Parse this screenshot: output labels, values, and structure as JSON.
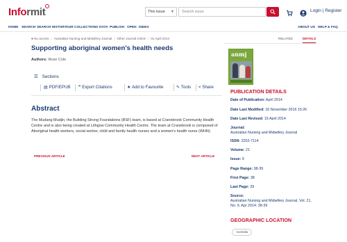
{
  "brand": {
    "logo_part1": "Info",
    "logo_part2": "rmit",
    "accent_color": "#c8102e",
    "link_color": "#1a3a6e"
  },
  "header": {
    "scope_select": "This issue",
    "search_placeholder": "Search issue",
    "search_icon": "search-icon",
    "cart_icon": "cart-icon",
    "user_icon": "user-icon",
    "login_label": "Login | Register"
  },
  "nav": {
    "left": [
      "HOME",
      "SEARCH",
      "SEARCH HISTORY",
      "OUR COLLECTIONS",
      "DATA",
      "PUBLISH",
      "OPEN",
      "INDEX"
    ],
    "right": [
      "ABOUT US",
      "HELP & FAQ"
    ]
  },
  "article": {
    "access": "No access",
    "journal": "Australian Nursing and Midwifery Journal",
    "type": "Other Journal Article",
    "date": "01 April 2014",
    "title": "Supporting aboriginal women's health needs",
    "authors_label": "Authors:",
    "authors_value": "Rose Cole",
    "sections_label": "Sections",
    "tools": {
      "pdf": "PDF/EPUB",
      "export": "Export Citations",
      "favourite": "Add to Favourite",
      "tools": "Tools",
      "share": "Share"
    },
    "abstract_heading": "Abstract",
    "abstract_text": "The Mudang Mudjin, the Building Strong Foundations (BSF) team, is based at Cranebrook Community Health Centre and is also being created at Lithgow Community Health Centre. The team at Cranebrook is composed of Aboriginal health workers, social worker, child and family health nurses and a women's health nurse (WHN).",
    "previous": "PREVIOUS ARTICLE",
    "next": "NEXT ARTICLE"
  },
  "panel": {
    "tabs": [
      "RELATED",
      "DETAILS"
    ],
    "active_tab": "DETAILS",
    "cover_title": "anmj",
    "publication_heading": "PUBLICATION DETAILS",
    "date_of_publication_label": "Date of Publication:",
    "date_of_publication": "April 2014",
    "last_modified_label": "Date Last Modified:",
    "last_modified": "16 November 2016 15:26",
    "last_revised_label": "Date Last Revised:",
    "last_revised": "15 April 2014",
    "journal_label": "Journal:",
    "journal": "Australian Nursing and Midwifery Journal",
    "issn_label": "ISSN:",
    "issn": "2202-7114",
    "volume_label": "Volume:",
    "volume": "21",
    "issue_label": "Issue:",
    "issue": "9",
    "page_range_label": "Page Range:",
    "page_range": "38-39",
    "first_page_label": "First Page:",
    "first_page": "38",
    "last_page_label": "Last Page:",
    "last_page": "39",
    "source_label": "Source:",
    "source": "Australian Nursing and Midwifery Journal, Vol. 21, No. 9, Apr 2014: 38-39",
    "geo_heading": "GEOGRAPHIC LOCATION",
    "geo_chip": "Australia"
  }
}
